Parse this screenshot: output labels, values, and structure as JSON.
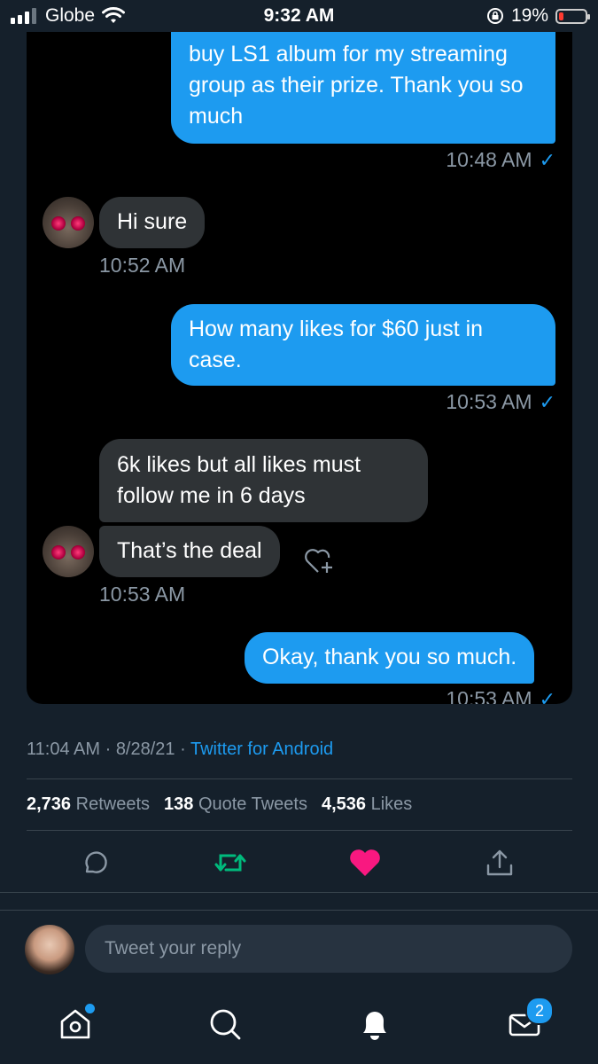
{
  "status_bar": {
    "carrier": "Globe",
    "time": "9:32 AM",
    "battery_percent": "19%",
    "battery_level": 0.19,
    "battery_color": "#ff3b30"
  },
  "chat": {
    "messages": [
      {
        "text": "buy LS1 album for my streaming group as their prize. Thank you so much",
        "time": "10:48 AM"
      },
      {
        "text": "Hi sure",
        "time": "10:52 AM"
      },
      {
        "text": "How many likes for $60  just in case.",
        "time": "10:53 AM"
      },
      {
        "text": "6k likes but all likes must follow me in 6 days"
      },
      {
        "text": "That’s the deal",
        "time": "10:53 AM"
      },
      {
        "text": "Okay, thank you so much.",
        "time": "10:53 AM"
      }
    ]
  },
  "tweet": {
    "time": "11:04 AM",
    "date": "8/28/21",
    "source": "Twitter for Android",
    "retweets_count": "2,736",
    "retweets_label": "Retweets",
    "quotes_count": "138",
    "quotes_label": "Quote Tweets",
    "likes_count": "4,536",
    "likes_label": "Likes"
  },
  "reply": {
    "placeholder": "Tweet your reply"
  },
  "tabbar": {
    "messages_badge": "2"
  },
  "colors": {
    "background": "#15202b",
    "accent": "#1d9bf0",
    "retweet": "#00ba7c",
    "like": "#f91880"
  },
  "icons": [
    "signal-icon",
    "wifi-icon",
    "orientation-lock-icon",
    "battery-icon",
    "read-check-icon",
    "heart-plus-icon",
    "reply-icon",
    "retweet-icon",
    "like-icon",
    "share-icon",
    "home-icon",
    "search-icon",
    "notifications-icon",
    "messages-icon"
  ]
}
